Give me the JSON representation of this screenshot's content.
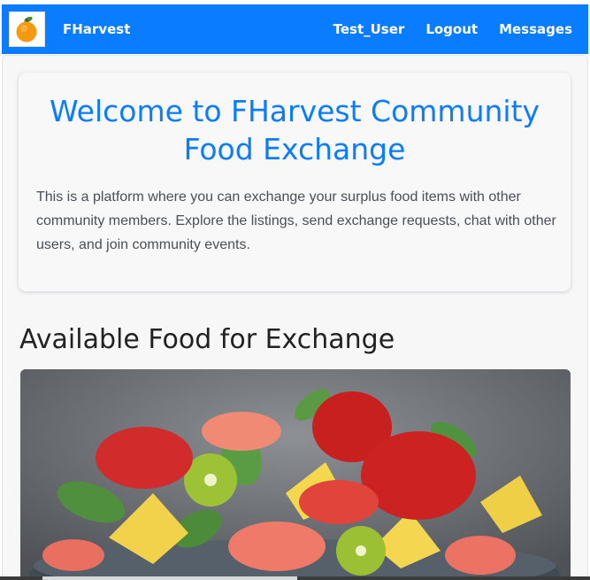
{
  "navbar": {
    "brand": "FHarvest",
    "logo_icon": "orange-icon",
    "links": [
      "Test_User",
      "Logout",
      "Messages"
    ],
    "background": "#0a7cff"
  },
  "welcome": {
    "title": "Welcome to FHarvest Community Food Exchange",
    "description": "This is a platform where you can exchange your surplus food items with other community members. Explore the listings, send exchange requests, chat with other users, and join community events."
  },
  "listings": {
    "heading": "Available Food for Exchange",
    "items": [
      {
        "image": "fruit-salad-bowl-photo"
      }
    ]
  },
  "colors": {
    "accent": "#0a7cff",
    "page_background": "#f7f7f8"
  }
}
